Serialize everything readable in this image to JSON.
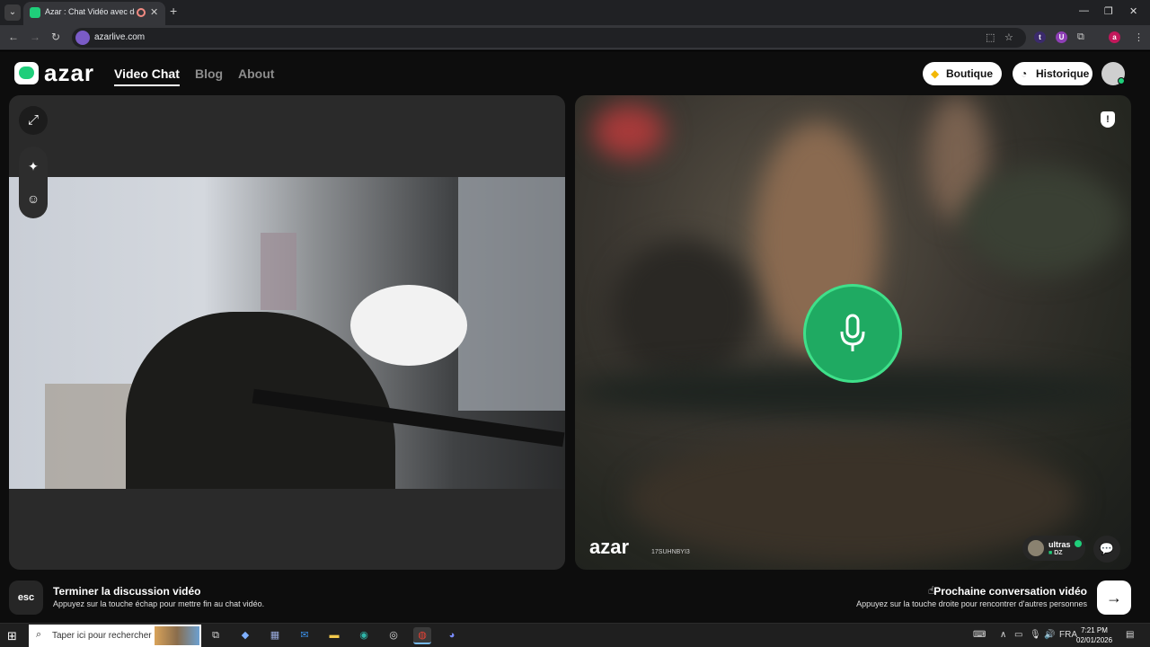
{
  "browser": {
    "tab_title": "Azar : Chat Vidéo avec de n",
    "url": "azarlive.com",
    "ext_t": "t",
    "ext_u": "U",
    "profile_initial": "a"
  },
  "header": {
    "logo_text": "azar",
    "nav": [
      "Video Chat",
      "Blog",
      "About"
    ],
    "boutique_label": "Boutique",
    "historique_label": "Historique"
  },
  "remote": {
    "watermark": "azar",
    "watermark_id": "17SUHNBYI3",
    "partner_name": "ultras",
    "partner_country": "DZ"
  },
  "bottom": {
    "esc_label": "esc",
    "end_title": "Terminer la discussion vidéo",
    "end_sub": "Appuyez sur la touche échap pour mettre fin au chat vidéo.",
    "next_title": "Prochaine conversation vidéo",
    "next_sub": "Appuyez sur la touche droite pour rencontrer d'autres personnes"
  },
  "taskbar": {
    "search_placeholder": "Taper ici pour rechercher",
    "lang": "FRA",
    "time": "7:21 PM",
    "date": "02/01/2026"
  },
  "colors": {
    "brand_green": "#1fce7a",
    "mic_green": "#1faa62"
  }
}
